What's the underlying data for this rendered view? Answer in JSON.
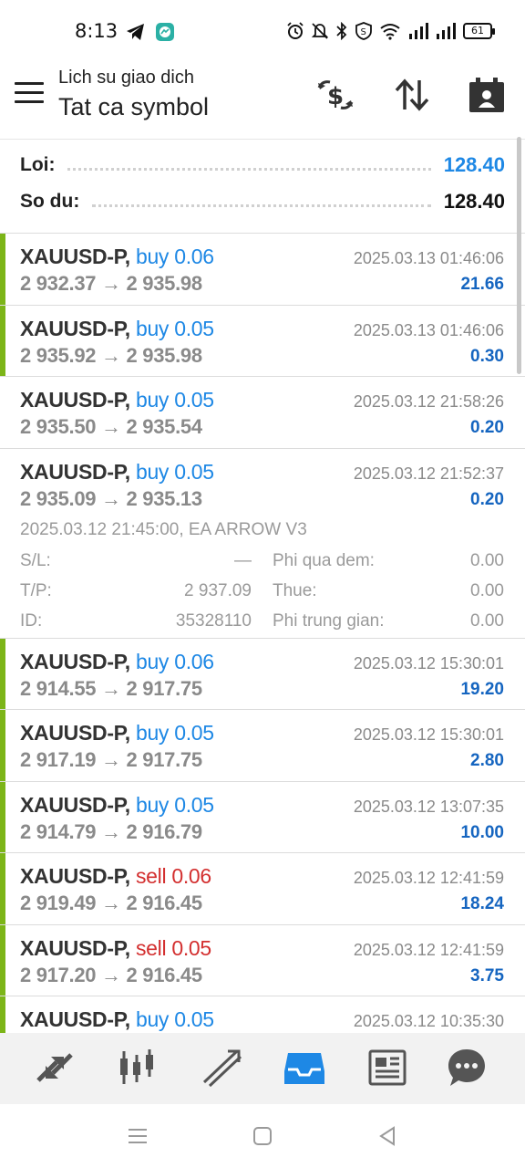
{
  "status_bar": {
    "time": "8:13",
    "battery": "61",
    "icons": [
      "telegram-icon",
      "messenger-icon",
      "alarm-icon",
      "mute-icon",
      "bluetooth-icon",
      "vpn-icon",
      "wifi-icon",
      "signal-icon",
      "signal-icon"
    ]
  },
  "header": {
    "subtitle": "Lich su giao dich",
    "title": "Tat ca symbol",
    "icons": [
      "currency-exchange-icon",
      "sort-icon",
      "calendar-icon"
    ]
  },
  "balance": {
    "profit_label": "Loi:",
    "profit_value": "128.40",
    "balance_label": "So du:",
    "balance_value": "128.40"
  },
  "trades": [
    {
      "symbol": "XAUUSD-P,",
      "side": "buy 0.06",
      "type": "buy",
      "prices": "2 932.37 → 2 935.98",
      "time": "2025.03.13 01:46:06",
      "profit": "21.66"
    },
    {
      "symbol": "XAUUSD-P,",
      "side": "buy 0.05",
      "type": "buy",
      "prices": "2 935.92 → 2 935.98",
      "time": "2025.03.13 01:46:06",
      "profit": "0.30"
    },
    {
      "symbol": "XAUUSD-P,",
      "side": "buy 0.05",
      "type": "buy",
      "prices": "2 935.50 → 2 935.54",
      "time": "2025.03.12 21:58:26",
      "profit": "0.20"
    },
    {
      "symbol": "XAUUSD-P,",
      "side": "buy 0.05",
      "type": "buy",
      "prices": "2 935.09 → 2 935.13",
      "time": "2025.03.12 21:52:37",
      "profit": "0.20",
      "expanded": {
        "open_info": "2025.03.12 21:45:00, EA ARROW V3",
        "sl_label": "S/L:",
        "sl_value": "—",
        "tp_label": "T/P:",
        "tp_value": "2 937.09",
        "id_label": "ID:",
        "id_value": "35328110",
        "swap_label": "Phi qua dem:",
        "swap_value": "0.00",
        "tax_label": "Thue:",
        "tax_value": "0.00",
        "commission_label": "Phi trung gian:",
        "commission_value": "0.00"
      }
    },
    {
      "symbol": "XAUUSD-P,",
      "side": "buy 0.06",
      "type": "buy",
      "prices": "2 914.55 → 2 917.75",
      "time": "2025.03.12 15:30:01",
      "profit": "19.20"
    },
    {
      "symbol": "XAUUSD-P,",
      "side": "buy 0.05",
      "type": "buy",
      "prices": "2 917.19 → 2 917.75",
      "time": "2025.03.12 15:30:01",
      "profit": "2.80"
    },
    {
      "symbol": "XAUUSD-P,",
      "side": "buy 0.05",
      "type": "buy",
      "prices": "2 914.79 → 2 916.79",
      "time": "2025.03.12 13:07:35",
      "profit": "10.00"
    },
    {
      "symbol": "XAUUSD-P,",
      "side": "sell 0.06",
      "type": "sell",
      "prices": "2 919.49 → 2 916.45",
      "time": "2025.03.12 12:41:59",
      "profit": "18.24"
    },
    {
      "symbol": "XAUUSD-P,",
      "side": "sell 0.05",
      "type": "sell",
      "prices": "2 917.20 → 2 916.45",
      "time": "2025.03.12 12:41:59",
      "profit": "3.75"
    },
    {
      "symbol": "XAUUSD-P,",
      "side": "buy 0.05",
      "type": "buy",
      "prices": "",
      "time": "2025.03.12 10:35:30",
      "profit": ""
    }
  ],
  "bottom_nav": [
    "quotes-icon",
    "chart-icon",
    "trade-icon",
    "history-icon",
    "news-icon",
    "messages-icon"
  ],
  "colors": {
    "buy": "#1e88e5",
    "sell": "#d32f2f",
    "profit": "#1565c0",
    "accent_bar": "#7cb518",
    "active_nav": "#1e88e5"
  }
}
